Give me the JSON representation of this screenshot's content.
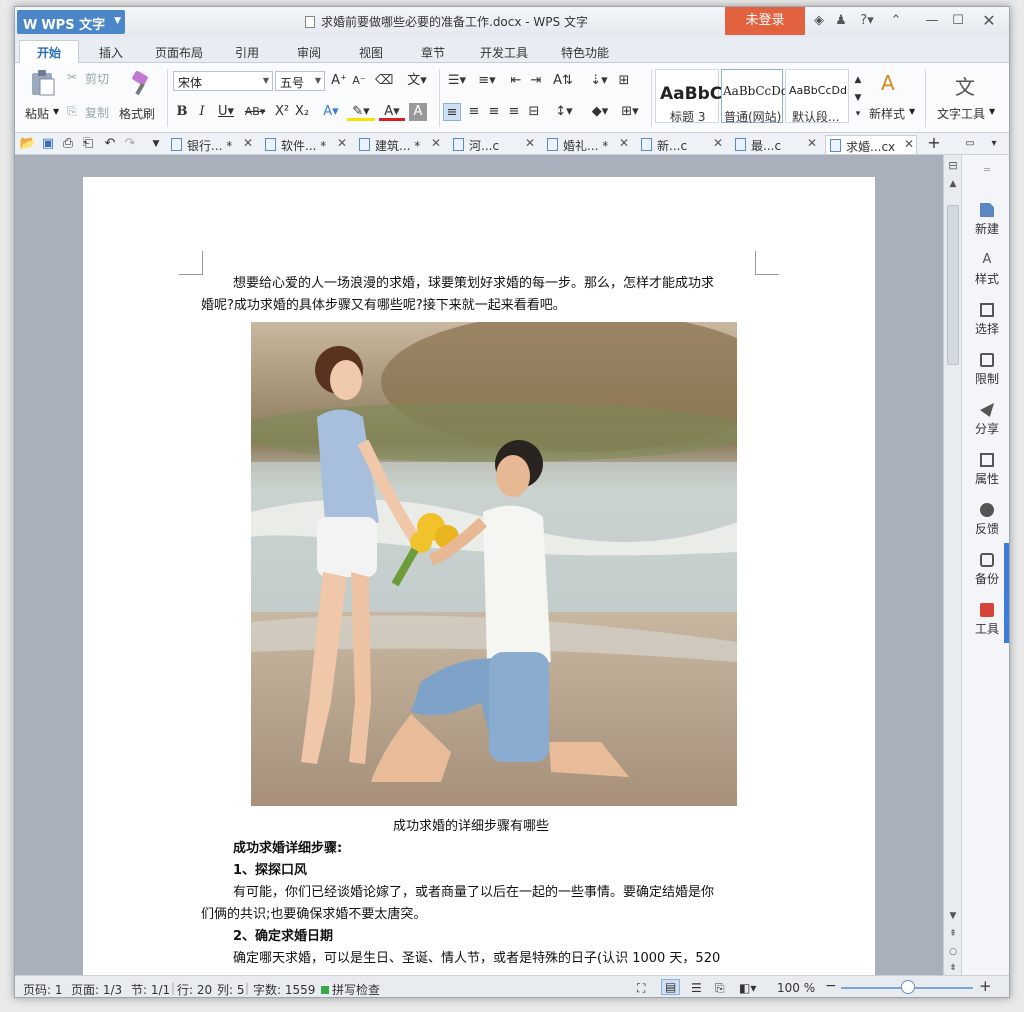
{
  "titlebar": {
    "app_name": "WPS 文字",
    "title": "求婚前要做哪些必要的准备工作.docx - WPS 文字",
    "login": "未登录",
    "help": "?"
  },
  "tabs": [
    "开始",
    "插入",
    "页面布局",
    "引用",
    "审阅",
    "视图",
    "章节",
    "开发工具",
    "特色功能"
  ],
  "ribbon": {
    "paste": "粘贴",
    "cut": "剪切",
    "copy": "复制",
    "format_painter": "格式刷",
    "font": "宋体",
    "size": "五号",
    "styles": [
      {
        "preview": "AaBbC",
        "name": "标题 3"
      },
      {
        "preview": "AaBbCcDd",
        "name": "普通(网站)"
      },
      {
        "preview": "AaBbCcDd",
        "name": "默认段..."
      }
    ],
    "new_style": "新样式",
    "text_tools": "文字工具"
  },
  "doc_tabs": [
    {
      "label": "银行... *"
    },
    {
      "label": "软件... *"
    },
    {
      "label": "建筑... *"
    },
    {
      "label": "河...c"
    },
    {
      "label": "婚礼... *"
    },
    {
      "label": "新...c"
    },
    {
      "label": "最...c"
    },
    {
      "label": "求婚...cx"
    }
  ],
  "document": {
    "intro_line1": "想要给心爱的人一场浪漫的求婚，球要策划好求婚的每一步。那么，怎样才能成功求",
    "intro_line2": "婚呢?成功求婚的具体步骤又有哪些呢?接下来就一起来看看吧。",
    "caption": "成功求婚的详细步骤有哪些",
    "steps_heading": "成功求婚详细步骤:",
    "step1_title": "1、探探口风",
    "step1_line1": "有可能，你们已经谈婚论嫁了，或者商量了以后在一起的一些事情。要确定结婚是你",
    "step1_line2": "们俩的共识;也要确保求婚不要太唐突。",
    "step2_title": "2、确定求婚日期",
    "step2_line1": "确定哪天求婚，可以是生日、圣诞、情人节，或者是特殊的日子(认识 1000 天，520"
  },
  "right_panel": [
    "新建",
    "样式",
    "选择",
    "限制",
    "分享",
    "属性",
    "反馈",
    "备份",
    "工具"
  ],
  "status": {
    "page_no": "页码: 1",
    "page": "页面: 1/3",
    "section": "节: 1/1",
    "row": "行: 20",
    "col": "列: 5",
    "words": "字数: 1559",
    "spell": "拼写检查",
    "zoom": "100 %"
  },
  "colors": {
    "accent": "#4a86c8",
    "login": "#e2623f"
  }
}
